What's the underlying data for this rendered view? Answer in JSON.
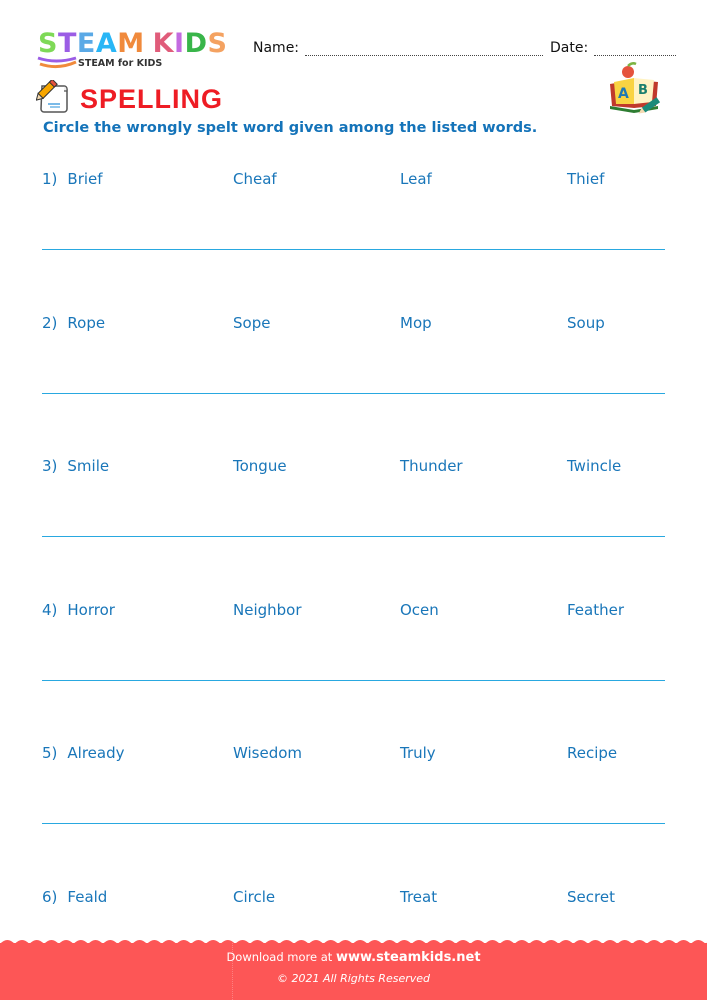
{
  "header": {
    "logo_letters": [
      {
        "char": "S",
        "color": "#7ed957"
      },
      {
        "char": "T",
        "color": "#9b5de5"
      },
      {
        "char": "E",
        "color": "#5aa9e6"
      },
      {
        "char": "A",
        "color": "#29b6f6"
      },
      {
        "char": "M",
        "color": "#f08a3c"
      },
      {
        "char": " ",
        "color": "#ffffff"
      },
      {
        "char": "K",
        "color": "#e05c7a"
      },
      {
        "char": "I",
        "color": "#c36be0"
      },
      {
        "char": "D",
        "color": "#39b54a"
      },
      {
        "char": "S",
        "color": "#f4a261"
      }
    ],
    "logo_subtitle": "STEAM for KIDS",
    "name_label": "Name:",
    "date_label": "Date:"
  },
  "title": "SPELLING",
  "instruction": "Circle the wrongly spelt word given among the listed words.",
  "questions": [
    {
      "number": "1)",
      "words": [
        "Brief",
        "Cheaf",
        "Leaf",
        "Thief"
      ]
    },
    {
      "number": "2)",
      "words": [
        "Rope",
        "Sope",
        "Mop",
        "Soup"
      ]
    },
    {
      "number": "3)",
      "words": [
        "Smile",
        "Tongue",
        "Thunder",
        "Twincle"
      ]
    },
    {
      "number": "4)",
      "words": [
        "Horror",
        "Neighbor",
        "Ocen",
        "Feather"
      ]
    },
    {
      "number": "5)",
      "words": [
        "Already",
        "Wisedom",
        "Truly",
        "Recipe"
      ]
    },
    {
      "number": "6)",
      "words": [
        "Feald",
        "Circle",
        "Treat",
        "Secret"
      ]
    }
  ],
  "footer": {
    "download_prefix": "Download more at",
    "website": "www.steamkids.net",
    "copyright": "© 2021 All Rights Reserved",
    "background_color": "#fd5656"
  },
  "colors": {
    "title_red": "#ee1c24",
    "text_blue": "#1976b9",
    "rule_blue": "#29a8e0"
  }
}
